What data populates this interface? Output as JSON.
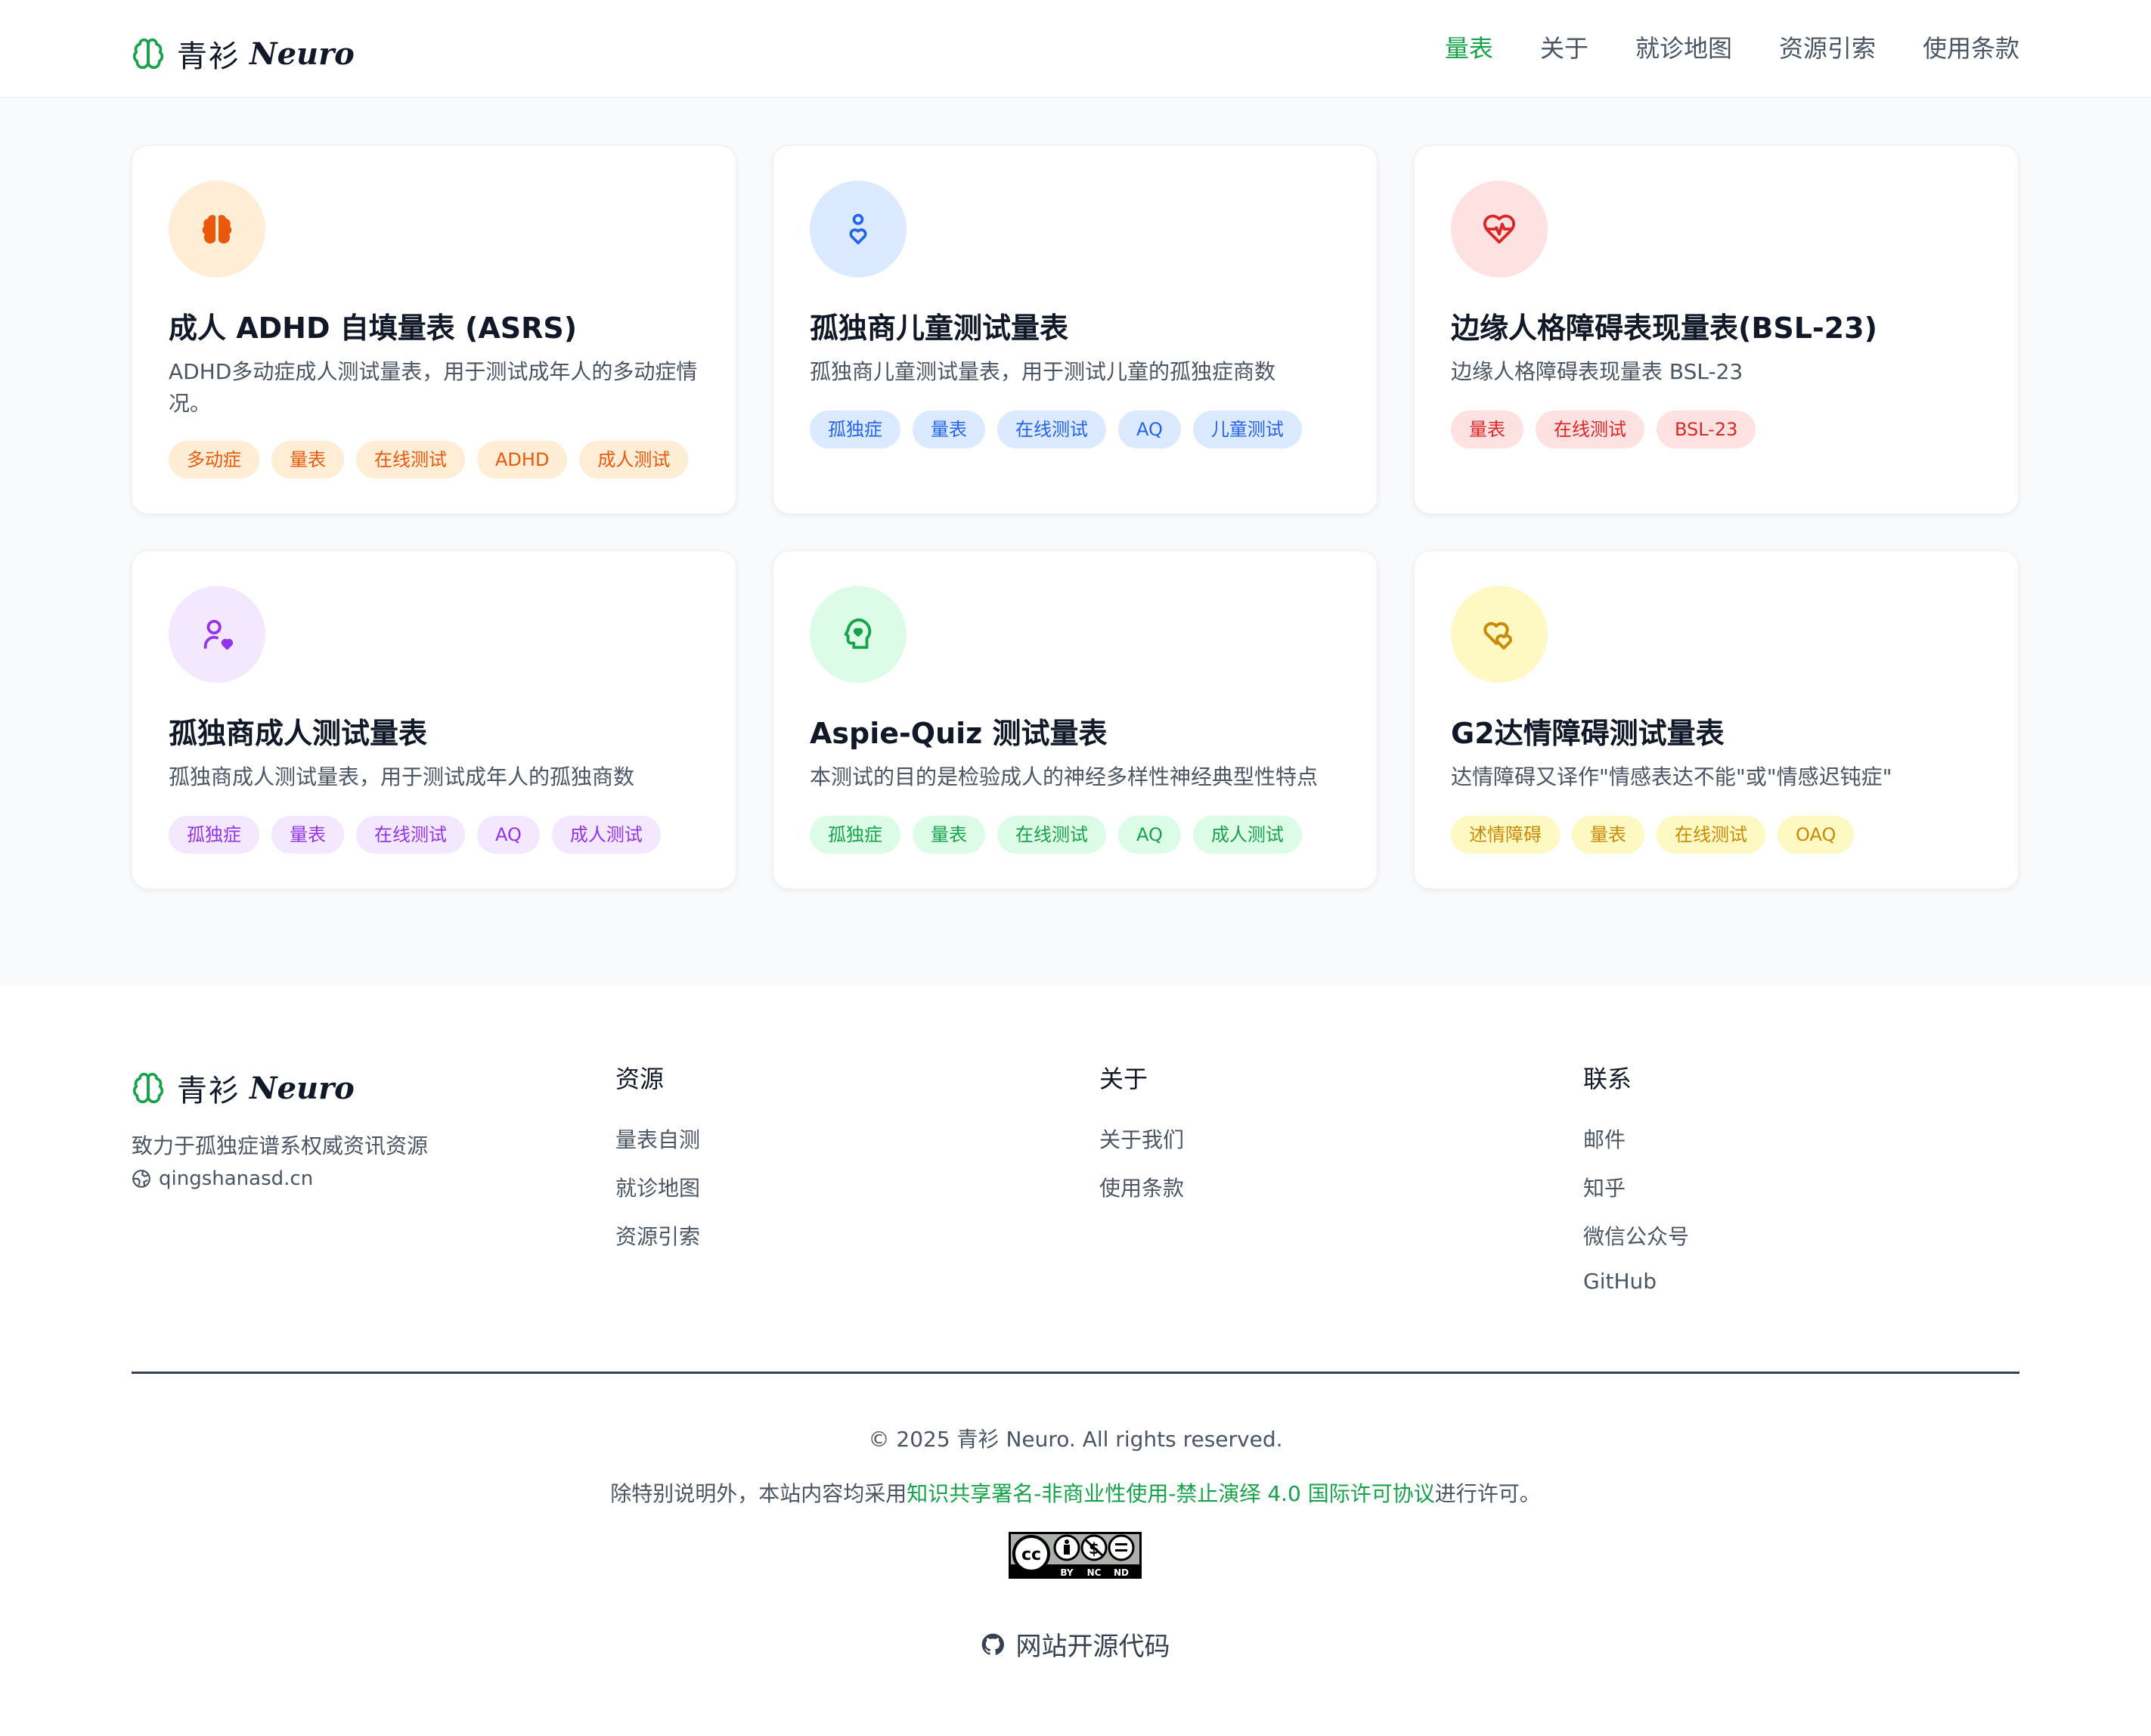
{
  "header": {
    "brand_cn": "青衫",
    "brand_en": "Neuro",
    "nav": [
      {
        "label": "量表",
        "active": true
      },
      {
        "label": "关于",
        "active": false
      },
      {
        "label": "就诊地图",
        "active": false
      },
      {
        "label": "资源引索",
        "active": false
      },
      {
        "label": "使用条款",
        "active": false
      }
    ]
  },
  "cards": [
    {
      "title": "成人 ADHD 自填量表 (ASRS)",
      "desc": "ADHD多动症成人测试量表，用于测试成年人的多动症情况。",
      "icon": "brain-icon",
      "tags": [
        "多动症",
        "量表",
        "在线测试",
        "ADHD",
        "成人测试"
      ],
      "color": "#ea580c"
    },
    {
      "title": "孤独商儿童测试量表",
      "desc": "孤独商儿童测试量表，用于测试儿童的孤独症商数",
      "icon": "person-heart-icon",
      "tags": [
        "孤独症",
        "量表",
        "在线测试",
        "AQ",
        "儿童测试"
      ],
      "color": "#2563eb"
    },
    {
      "title": "边缘人格障碍表现量表(BSL-23)",
      "desc": "边缘人格障碍表现量表 BSL-23",
      "icon": "heart-pulse-icon",
      "tags": [
        "量表",
        "在线测试",
        "BSL-23"
      ],
      "color": "#dc2626"
    },
    {
      "title": "孤独商成人测试量表",
      "desc": "孤独商成人测试量表，用于测试成年人的孤独商数",
      "icon": "user-heart-icon",
      "tags": [
        "孤独症",
        "量表",
        "在线测试",
        "AQ",
        "成人测试"
      ],
      "color": "#9333ea"
    },
    {
      "title": "Aspie-Quiz 测试量表",
      "desc": "本测试的目的是检验成人的神经多样性神经典型性特点",
      "icon": "head-heart-icon",
      "tags": [
        "孤独症",
        "量表",
        "在线测试",
        "AQ",
        "成人测试"
      ],
      "color": "#16a34a"
    },
    {
      "title": "G2达情障碍测试量表",
      "desc": "达情障碍又译作\"情感表达不能\"或\"情感迟钝症\"",
      "icon": "hearts-icon",
      "tags": [
        "述情障碍",
        "量表",
        "在线测试",
        "OAQ"
      ],
      "color": "#ca8a04"
    }
  ],
  "footer": {
    "brand_cn": "青衫",
    "brand_en": "Neuro",
    "tagline": "致力于孤独症谱系权威资讯资源",
    "website": "qingshanasd.cn",
    "columns": [
      {
        "title": "资源",
        "links": [
          "量表自测",
          "就诊地图",
          "资源引索"
        ]
      },
      {
        "title": "关于",
        "links": [
          "关于我们",
          "使用条款"
        ]
      },
      {
        "title": "联系",
        "links": [
          "邮件",
          "知乎",
          "微信公众号",
          "GitHub"
        ]
      }
    ],
    "copyright": "© 2025 青衫 Neuro. All rights reserved.",
    "license_prefix": "除特别说明外，本站内容均采用",
    "license_link": "知识共享署名-非商业性使用-禁止演绎 4.0 国际许可协议",
    "license_suffix": "进行许可。",
    "cc_labels": [
      "BY",
      "NC",
      "ND"
    ],
    "source_link": "网站开源代码"
  },
  "colors": {
    "accent": "#16a34a",
    "orange_bg": "#ffedd5",
    "orange_fg": "#ea580c",
    "blue_bg": "#dbeafe",
    "blue_fg": "#2563eb",
    "red_bg": "#fee2e2",
    "red_fg": "#dc2626",
    "purple_bg": "#f3e8ff",
    "purple_fg": "#9333ea",
    "green_bg": "#dcfce7",
    "green_fg": "#16a34a",
    "yellow_bg": "#fef9c3",
    "yellow_fg": "#ca8a04"
  }
}
